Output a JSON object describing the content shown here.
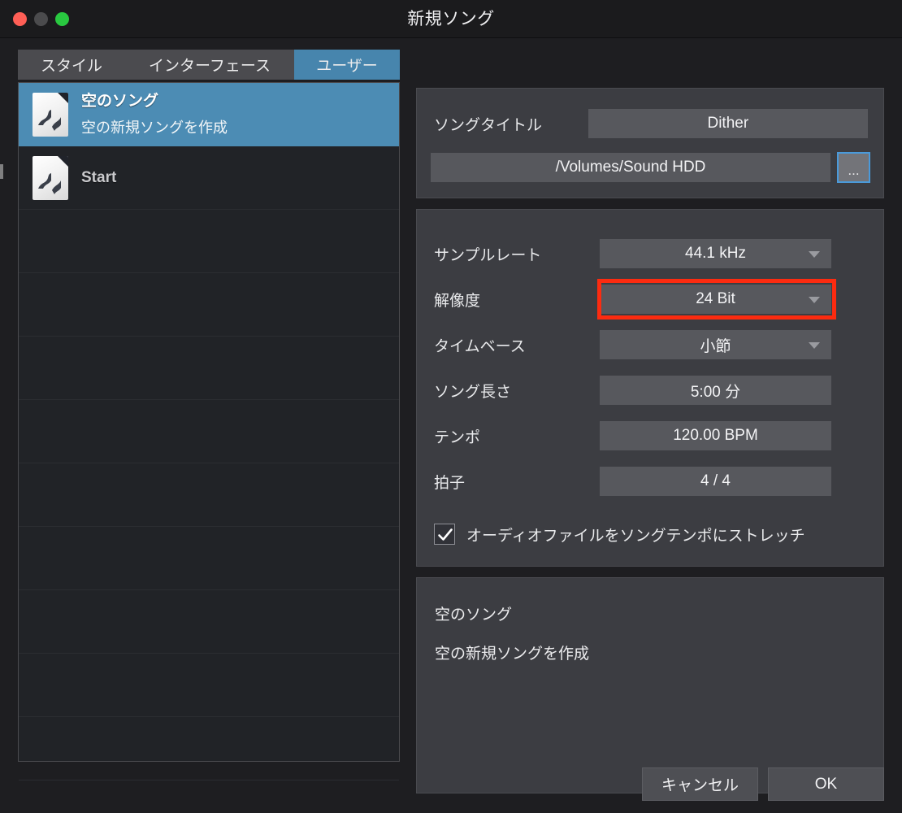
{
  "window": {
    "title": "新規ソング",
    "traffic_lights": [
      "close",
      "minimize",
      "zoom"
    ],
    "accent_color": "#4785ad",
    "highlight_color": "#fc2b10"
  },
  "tabs": [
    {
      "label": "スタイル",
      "selected": false
    },
    {
      "label": "インターフェース",
      "selected": false
    },
    {
      "label": "ユーザー",
      "selected": true
    }
  ],
  "template_list": {
    "items": [
      {
        "title": "空のソング",
        "subtitle": "空の新規ソングを作成",
        "selected": true
      },
      {
        "title": "Start",
        "subtitle": "",
        "selected": false
      }
    ],
    "empty_row_count": 9
  },
  "song_title": {
    "label": "ソングタイトル",
    "value": "Dither"
  },
  "path": {
    "value": "/Volumes/Sound HDD",
    "browse_label": "..."
  },
  "params": [
    {
      "key": "sample_rate",
      "label": "サンプルレート",
      "value": "44.1 kHz",
      "type": "select"
    },
    {
      "key": "resolution",
      "label": "解像度",
      "value": "24 Bit",
      "type": "select",
      "highlighted": true
    },
    {
      "key": "timebase",
      "label": "タイムベース",
      "value": "小節",
      "type": "select"
    },
    {
      "key": "song_length",
      "label": "ソング長さ",
      "value": "5:00 分",
      "type": "text"
    },
    {
      "key": "tempo",
      "label": "テンポ",
      "value": "120.00 BPM",
      "type": "text"
    },
    {
      "key": "time_sig",
      "label": "拍子",
      "value": "4  /  4",
      "type": "text"
    }
  ],
  "stretch_option": {
    "label": "オーディオファイルをソングテンポにストレッチ",
    "checked": true
  },
  "description": {
    "title": "空のソング",
    "body": "空の新規ソングを作成"
  },
  "footer": {
    "cancel_label": "キャンセル",
    "ok_label": "OK"
  }
}
